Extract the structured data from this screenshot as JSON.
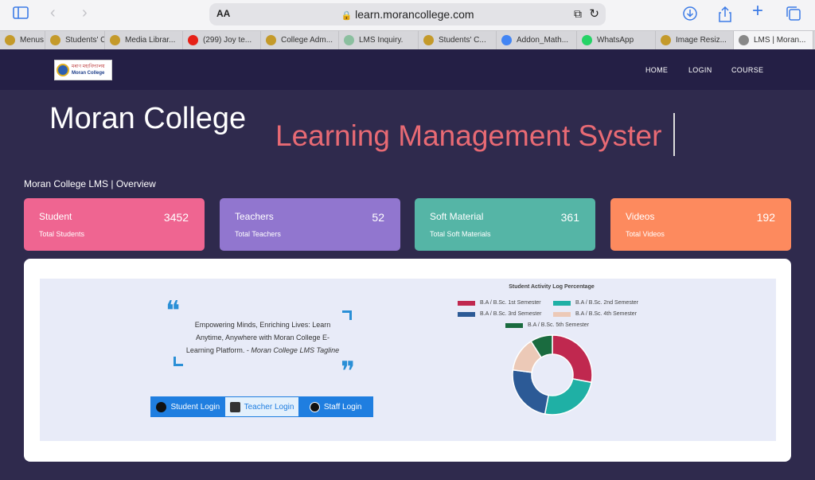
{
  "browser": {
    "aa_label": "AA",
    "url": "learn.morancollege.com",
    "tabs": [
      {
        "label": "Menus",
        "color": "#c49a2a"
      },
      {
        "label": "Students' C",
        "color": "#c49a2a"
      },
      {
        "label": "Media Librar...",
        "color": "#c49a2a"
      },
      {
        "label": "(299) Joy te...",
        "color": "#e62117"
      },
      {
        "label": "College Adm...",
        "color": "#c49a2a"
      },
      {
        "label": "LMS Inquiry.",
        "color": "#8bbf9f"
      },
      {
        "label": "Students' C...",
        "color": "#c49a2a"
      },
      {
        "label": "Addon_Math...",
        "color": "#4285f4"
      },
      {
        "label": "WhatsApp",
        "color": "#25d366"
      },
      {
        "label": "Image Resiz...",
        "color": "#c49a2a"
      },
      {
        "label": "LMS | Moran...",
        "color": "#888888"
      }
    ]
  },
  "site": {
    "logo_line1": "মৰাণ মহাবিদ্যালয়",
    "logo_line2": "Moran College",
    "nav": {
      "home": "HOME",
      "login": "LOGIN",
      "course": "COURSE"
    },
    "hero_title": "Moran College",
    "hero_subtitle": "Learning Management Syster",
    "overview": "Moran College LMS | Overview"
  },
  "cards": [
    {
      "title": "Student",
      "subtitle": "Total Students",
      "value": "3452",
      "color": "#ef6591"
    },
    {
      "title": "Teachers",
      "subtitle": "Total Teachers",
      "value": "52",
      "color": "#9176cf"
    },
    {
      "title": "Soft Material",
      "subtitle": "Total Soft Materials",
      "value": "361",
      "color": "#55b5a6"
    },
    {
      "title": "Videos",
      "subtitle": "Total Videos",
      "value": "192",
      "color": "#fd8a5e"
    }
  ],
  "panel": {
    "tagline": "Empowering Minds, Enriching Lives: Learn Anytime, Anywhere with Moran College E-Learning Platform. - ",
    "tagline_source": "Moran College LMS Tagline",
    "login_buttons": {
      "student": "Student Login",
      "teacher": "Teacher Login",
      "staff": "Staff Login"
    }
  },
  "chart_data": {
    "type": "pie",
    "title": "Student Activity Log Percentage",
    "categories": [
      "B.A / B.Sc. 1st Semester",
      "B.A / B.Sc. 2nd Semester",
      "B.A / B.Sc. 3rd Semester",
      "B.A / B.Sc. 4th Semester",
      "B.A / B.Sc. 5th Semester"
    ],
    "values": [
      28,
      25,
      24,
      14,
      9
    ],
    "colors": [
      "#c0284f",
      "#1fb0a5",
      "#2c5a96",
      "#ecc9b7",
      "#1a6b3f"
    ],
    "donut": true,
    "legend": "top"
  }
}
